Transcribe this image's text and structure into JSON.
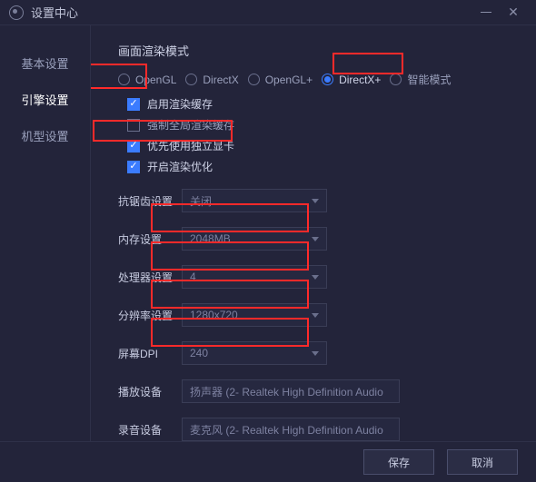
{
  "window": {
    "title": "设置中心"
  },
  "sidebar": {
    "items": [
      {
        "label": "基本设置"
      },
      {
        "label": "引擎设置"
      },
      {
        "label": "机型设置"
      }
    ],
    "active_index": 1
  },
  "render_mode": {
    "title": "画面渲染模式",
    "options": [
      {
        "label": "OpenGL",
        "selected": false
      },
      {
        "label": "DirectX",
        "selected": false
      },
      {
        "label": "OpenGL+",
        "selected": false
      },
      {
        "label": "DirectX+",
        "selected": true
      },
      {
        "label": "智能模式",
        "selected": false
      }
    ],
    "checks": [
      {
        "label": "启用渲染缓存",
        "checked": true
      },
      {
        "label": "强制全局渲染缓存",
        "checked": false
      },
      {
        "label": "优先使用独立显卡",
        "checked": true
      },
      {
        "label": "开启渲染优化",
        "checked": true
      }
    ]
  },
  "settings": {
    "antialias": {
      "label": "抗锯齿设置",
      "value": "关闭"
    },
    "memory": {
      "label": "内存设置",
      "value": "2048MB"
    },
    "cpu": {
      "label": "处理器设置",
      "value": "4"
    },
    "resolution": {
      "label": "分辨率设置",
      "value": "1280x720"
    },
    "dpi": {
      "label": "屏幕DPI",
      "value": "240"
    },
    "playback": {
      "label": "播放设备",
      "value": "扬声器 (2- Realtek High Definition Audio"
    },
    "record": {
      "label": "录音设备",
      "value": "麦克风 (2- Realtek High Definition Audio"
    }
  },
  "footer": {
    "save": "保存",
    "cancel": "取消"
  },
  "highlight_color": "#ff2a2a"
}
